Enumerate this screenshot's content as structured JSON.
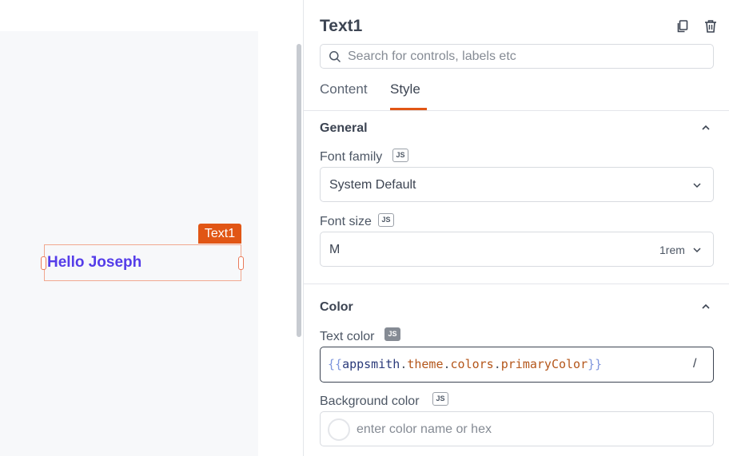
{
  "canvas": {
    "widget_tag": "Text1",
    "widget_text": "Hello Joseph"
  },
  "pane": {
    "title": "Text1",
    "copy_icon": "copy-icon",
    "delete_icon": "trash-icon",
    "search": {
      "placeholder": "Search for controls, labels etc",
      "value": ""
    },
    "tabs": [
      {
        "label": "Content",
        "active": false
      },
      {
        "label": "Style",
        "active": true
      }
    ],
    "sections": {
      "general": {
        "title": "General",
        "font_family": {
          "label": "Font family",
          "badge": "JS",
          "value": "System Default"
        },
        "font_size": {
          "label": "Font size",
          "badge": "JS",
          "value": "M",
          "unit": "1rem"
        }
      },
      "color": {
        "title": "Color",
        "text_color": {
          "label": "Text color",
          "badge": "JS",
          "open_brace": "{{",
          "root": "appsmith",
          "path1": "theme",
          "path2": "colors",
          "path3": "primaryColor",
          "close_brace": "}}",
          "slash_hint": "/"
        },
        "background_color": {
          "label": "Background color",
          "badge": "JS",
          "placeholder": "enter color name or hex",
          "value": ""
        }
      }
    }
  },
  "colors": {
    "accent": "#e15615",
    "widget_text": "#553de9",
    "canvas_bg": "#f7f8fa"
  }
}
